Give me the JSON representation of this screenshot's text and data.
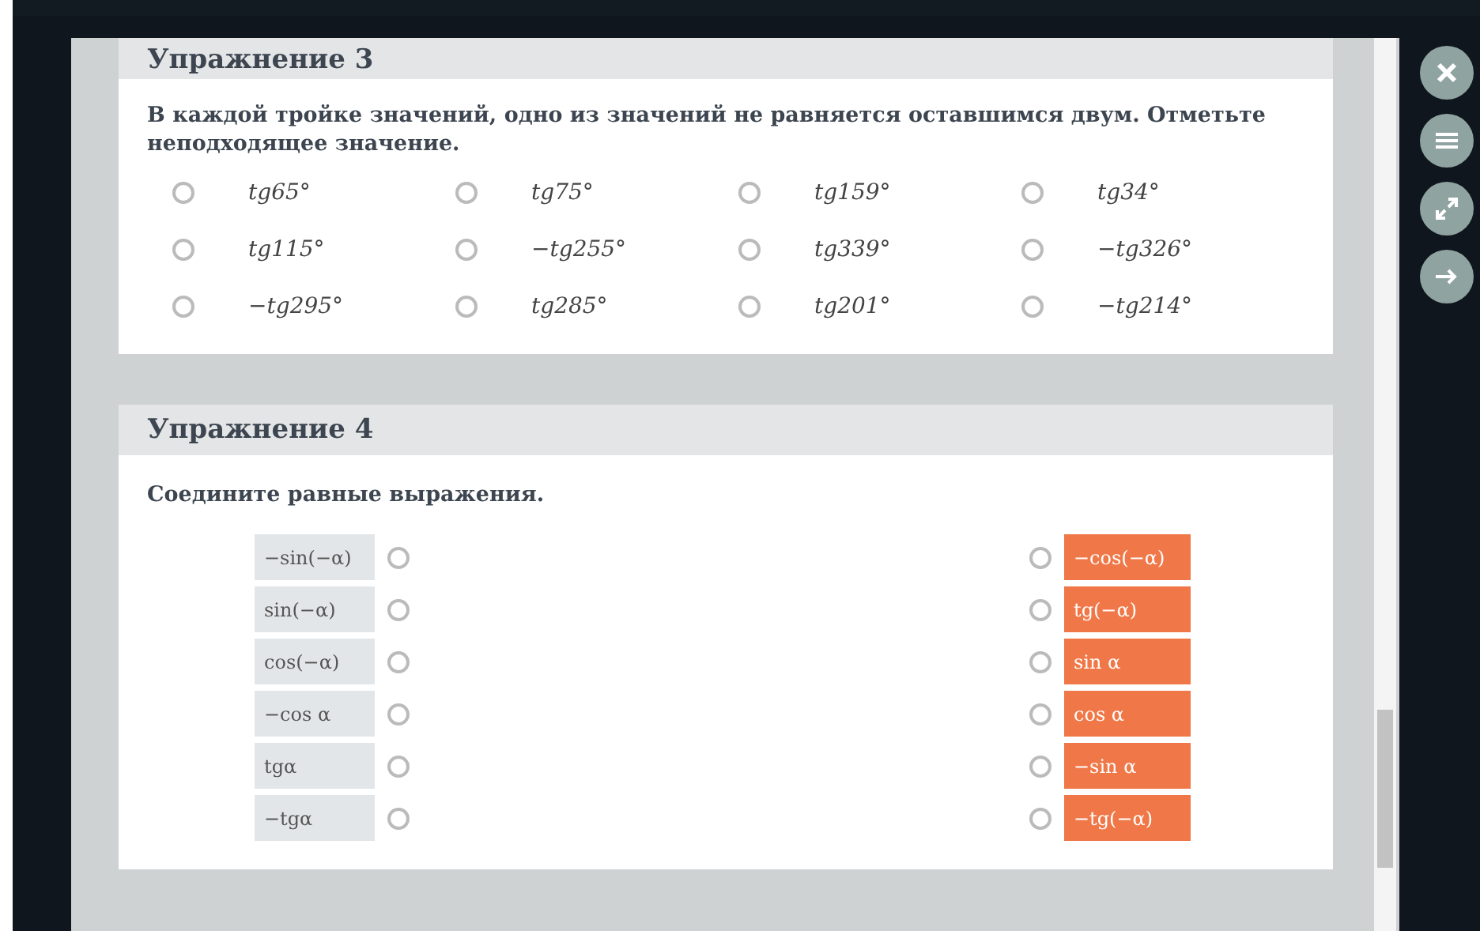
{
  "exercises": [
    {
      "title": "Упражнение 3",
      "kind": "choice",
      "prompt": "В каждой тройке значений, одно из значений не равняется оставшимся двум. Отметьте неподходящее значение.",
      "options": [
        {
          "label": "tg65°",
          "selected": false
        },
        {
          "label": "tg75°",
          "selected": false
        },
        {
          "label": "tg159°",
          "selected": false
        },
        {
          "label": "tg34°",
          "selected": false
        },
        {
          "label": "tg115°",
          "selected": false
        },
        {
          "label": "−tg255°",
          "selected": false
        },
        {
          "label": "tg339°",
          "selected": false
        },
        {
          "label": "−tg326°",
          "selected": false
        },
        {
          "label": "−tg295°",
          "selected": false
        },
        {
          "label": "tg285°",
          "selected": false
        },
        {
          "label": "tg201°",
          "selected": false
        },
        {
          "label": "−tg214°",
          "selected": false
        }
      ]
    },
    {
      "title": "Упражнение 4",
      "kind": "match",
      "prompt": "Соедините равные выражения.",
      "left": [
        {
          "label": "−sin(−α)",
          "selected": false
        },
        {
          "label": "sin(−α)",
          "selected": false
        },
        {
          "label": "cos(−α)",
          "selected": false
        },
        {
          "label": "−cos α",
          "selected": false
        },
        {
          "label": "tgα",
          "selected": false
        },
        {
          "label": "−tgα",
          "selected": false
        }
      ],
      "right": [
        {
          "label": "−cos(−α)",
          "selected": false
        },
        {
          "label": "tg(−α)",
          "selected": false
        },
        {
          "label": "sin α",
          "selected": false
        },
        {
          "label": "cos α",
          "selected": false
        },
        {
          "label": "−sin α",
          "selected": false
        },
        {
          "label": "−tg(−α)",
          "selected": false
        }
      ]
    }
  ]
}
